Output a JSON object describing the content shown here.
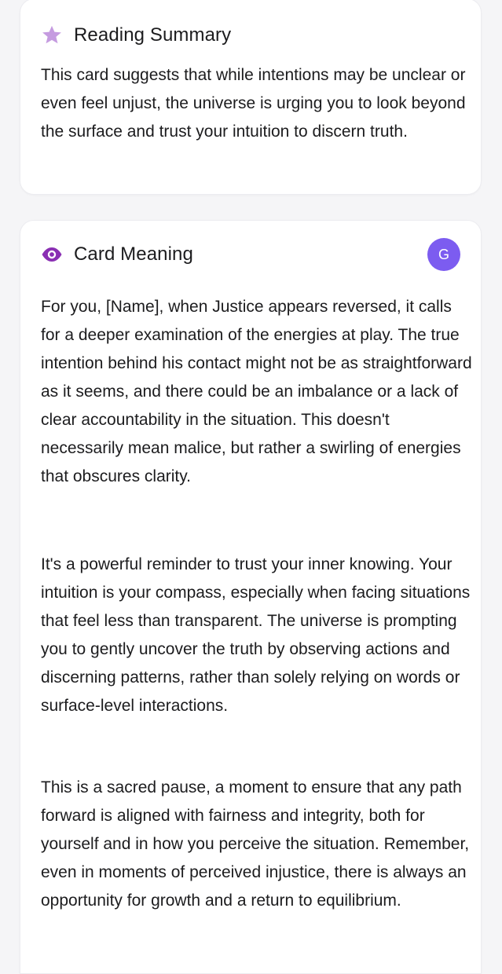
{
  "summary": {
    "icon": "star-icon",
    "title": "Reading Summary",
    "text": "This card suggests that while intentions may be unclear or even feel unjust, the universe is urging you to look beyond the surface and trust your intuition to discern truth."
  },
  "meaning": {
    "icon": "eye-icon",
    "title": "Card Meaning",
    "avatar_letter": "G",
    "paragraphs": [
      "For you, [Name], when Justice appears reversed, it calls for a deeper examination of the energies at play. The true intention behind his contact might not be as straightforward as it seems, and there could be an imbalance or a lack of clear accountability in the situation. This doesn't necessarily mean malice, but rather a swirling of energies that obscures clarity.",
      "It's a powerful reminder to trust your inner knowing. Your intuition is your compass, especially when facing situations that feel less than transparent. The universe is prompting you to gently uncover the truth by observing actions and discerning patterns, rather than solely relying on words or surface-level interactions.",
      "This is a sacred pause, a moment to ensure that any path forward is aligned with fairness and integrity, both for yourself and in how you perceive the situation. Remember, even in moments of perceived injustice, there is always an opportunity for growth and a return to equilibrium."
    ]
  },
  "colors": {
    "star": "#c59be0",
    "eye": "#8a2fb3",
    "avatar_bg": "#7c5cf0",
    "page_bg": "#f5f5f7",
    "card_bg": "#ffffff"
  }
}
